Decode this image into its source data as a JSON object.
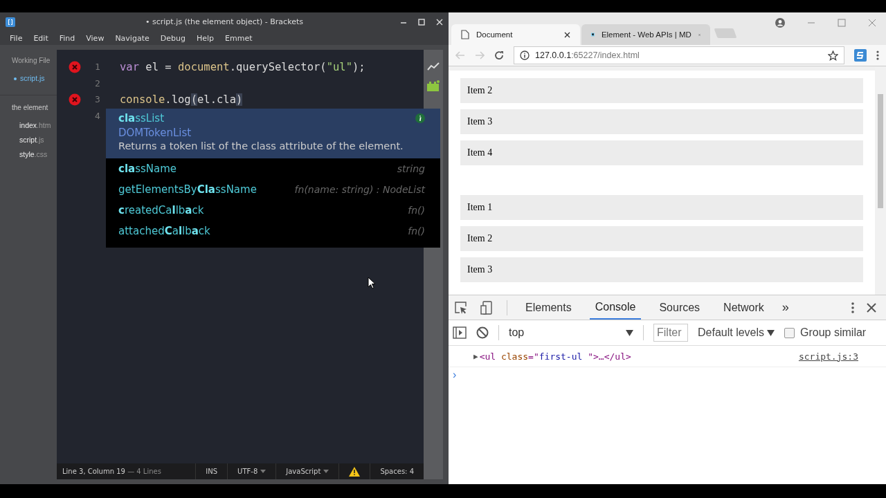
{
  "editor": {
    "title": "• script.js (the element object) - Brackets",
    "menu": [
      "File",
      "Edit",
      "Find",
      "View",
      "Navigate",
      "Debug",
      "Help",
      "Emmet"
    ],
    "sidebar": {
      "working_files_label": "Working File",
      "working_files": [
        {
          "name": "script.js",
          "selected": true
        }
      ],
      "project_label": "the element",
      "files": [
        {
          "name": "index",
          "ext": ".htm"
        },
        {
          "name": "script",
          "ext": ".js"
        },
        {
          "name": "style",
          "ext": ".css"
        }
      ]
    },
    "code_lines": [
      {
        "number": "1",
        "error": true,
        "tokens": [
          {
            "text": "var",
            "kind": "keyword"
          },
          {
            "text": " el = ",
            "kind": "plain"
          },
          {
            "text": "document",
            "kind": "global"
          },
          {
            "text": ".querySelector(",
            "kind": "plain"
          },
          {
            "text": "\"ul\"",
            "kind": "string"
          },
          {
            "text": ");",
            "kind": "plain"
          }
        ]
      },
      {
        "number": "2",
        "error": false
      },
      {
        "number": "3",
        "error": true,
        "tokens": [
          {
            "text": "console",
            "kind": "global"
          },
          {
            "text": ".log",
            "kind": "plain"
          },
          {
            "text": "(",
            "kind": "match"
          },
          {
            "text": "el.cla",
            "kind": "plain"
          },
          {
            "text": ")",
            "kind": "match"
          }
        ]
      },
      {
        "number": "4",
        "error": false
      }
    ],
    "hints": [
      {
        "name": "**cla**ssList",
        "type": "DOMTokenList",
        "description": "Returns a token list of the class attribute of the element.",
        "selected": true
      },
      {
        "name": "**cla**ssName",
        "type": "string",
        "selected": false
      },
      {
        "name": "getElementsBy**Cla**ssName",
        "type": "fn(name: string) : NodeList",
        "selected": false
      },
      {
        "name": "**c**reatedCa**l**lb**a**ck",
        "type": "fn()",
        "selected": false
      },
      {
        "name": "attached**C**a**l**lb**a**ck",
        "type": "fn()",
        "selected": false
      }
    ],
    "status": {
      "position": "Line 3, Column 19",
      "lines": "— 4 Lines",
      "mode": "INS",
      "encoding": "UTF-8",
      "language": "JavaScript",
      "spaces": "Spaces: 4"
    }
  },
  "browser": {
    "tabs": [
      {
        "title": "Document",
        "kind": "page",
        "selected": true
      },
      {
        "title": "Element - Web APIs | MD",
        "kind": "dino",
        "selected": false
      }
    ],
    "url_host": "127.0.0.1",
    "url_rest": ":65227/index.html",
    "lists": [
      [
        "Item 2",
        "Item 3",
        "Item 4"
      ],
      [
        "Item 1",
        "Item 2",
        "Item 3"
      ]
    ],
    "devtools": {
      "tabs": [
        {
          "label": "Elements",
          "selected": false
        },
        {
          "label": "Console",
          "selected": true
        },
        {
          "label": "Sources",
          "selected": false
        },
        {
          "label": "Network",
          "selected": false
        }
      ],
      "more": "»",
      "context": "top",
      "filter_placeholder": "Filter",
      "levels": "Default levels",
      "group_similar": {
        "label": "Group similar",
        "checked": false
      },
      "log": {
        "expander": "▶",
        "tokens": [
          {
            "text": "<ul ",
            "kind": "tag"
          },
          {
            "text": "class",
            "kind": "attr"
          },
          {
            "text": "=\"",
            "kind": "tag"
          },
          {
            "text": "first-ul ",
            "kind": "value"
          },
          {
            "text": "\">…</ul>",
            "kind": "tag"
          }
        ],
        "source": "script.js:3"
      },
      "prompt": "›"
    }
  }
}
